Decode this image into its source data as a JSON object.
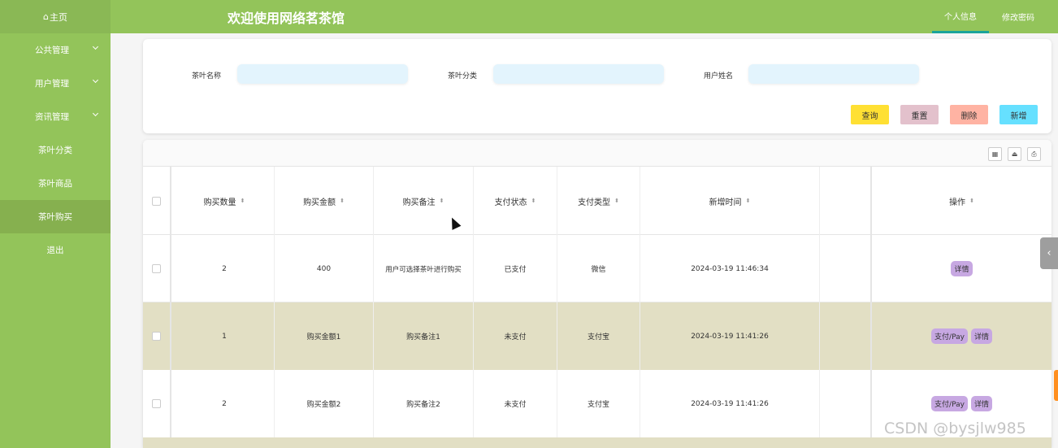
{
  "header": {
    "home_label": "主页",
    "home_icon": "⌂",
    "title": "欢迎使用网络茗茶馆",
    "nav": [
      "个人信息",
      "修改密码"
    ]
  },
  "sidebar": {
    "items": [
      {
        "label": "公共管理",
        "expandable": true
      },
      {
        "label": "用户管理",
        "expandable": true
      },
      {
        "label": "资讯管理",
        "expandable": true
      },
      {
        "label": "茶叶分类",
        "expandable": false
      },
      {
        "label": "茶叶商品",
        "expandable": false
      },
      {
        "label": "茶叶购买",
        "expandable": false,
        "active": true
      },
      {
        "label": "退出",
        "expandable": false
      }
    ]
  },
  "search": {
    "fields": [
      {
        "label": "茶叶名称",
        "value": ""
      },
      {
        "label": "茶叶分类",
        "value": ""
      },
      {
        "label": "用户姓名",
        "value": ""
      }
    ],
    "buttons": [
      {
        "label": "查询",
        "color": "#ffe033"
      },
      {
        "label": "重置",
        "color": "#e3c1cc"
      },
      {
        "label": "删除",
        "color": "#ffb3a3"
      },
      {
        "label": "新增",
        "color": "#66e0ff"
      }
    ]
  },
  "table": {
    "toolbar_icons": [
      "columns-icon",
      "export-icon",
      "print-icon"
    ],
    "columns": [
      "购买数量",
      "购买金额",
      "购买备注",
      "支付状态",
      "支付类型",
      "新增时间",
      "",
      "操作"
    ],
    "rows": [
      {
        "qty": "2",
        "amount": "400",
        "note": "用户可选择茶叶进行购买",
        "status": "已支付",
        "type": "微信",
        "time": "2024-03-19 11:46:34",
        "actions": [
          "详情"
        ],
        "bg": "#ffffff"
      },
      {
        "qty": "1",
        "amount": "购买金额1",
        "note": "购买备注1",
        "status": "未支付",
        "type": "支付宝",
        "time": "2024-03-19 11:41:26",
        "actions": [
          "支付/Pay",
          "详情"
        ],
        "bg": "#e2dfc4"
      },
      {
        "qty": "2",
        "amount": "购买金额2",
        "note": "购买备注2",
        "status": "未支付",
        "type": "支付宝",
        "time": "2024-03-19 11:41:26",
        "actions": [
          "支付/Pay",
          "详情"
        ],
        "bg": "#ffffff"
      }
    ]
  },
  "watermark": "CSDN @bysjlw985"
}
